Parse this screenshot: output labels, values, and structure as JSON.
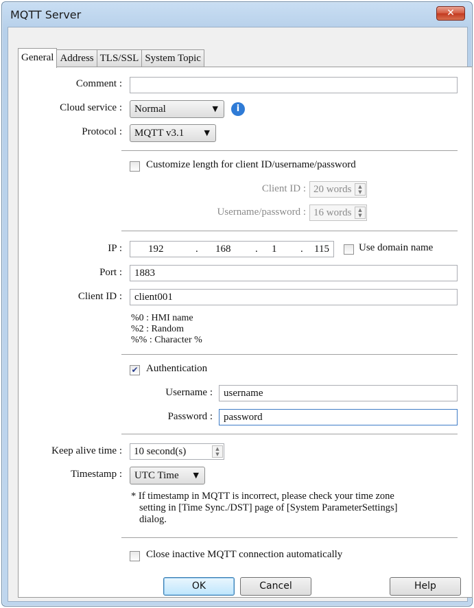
{
  "window": {
    "title": "MQTT Server",
    "close_label": "✕"
  },
  "tabs": [
    {
      "label": "General"
    },
    {
      "label": "Address"
    },
    {
      "label": "TLS/SSL"
    },
    {
      "label": "System Topic"
    }
  ],
  "general": {
    "comment_label": "Comment :",
    "comment_value": "",
    "cloud_label": "Cloud service :",
    "cloud_value": "Normal",
    "protocol_label": "Protocol :",
    "protocol_value": "MQTT v3.1",
    "customize_label": "Customize length for client ID/username/password",
    "customize_checked": false,
    "len_client_label": "Client ID :",
    "len_client_value": "20 words",
    "len_user_label": "Username/password :",
    "len_user_value": "16 words",
    "ip_label": "IP :",
    "ip": [
      "192",
      "168",
      "1",
      "115"
    ],
    "ip_dot": ".",
    "use_domain_label": "Use domain name",
    "use_domain_checked": false,
    "port_label": "Port :",
    "port_value": "1883",
    "client_id_label": "Client ID :",
    "client_id_value": "client001",
    "hints": [
      "%0 : HMI name",
      "%2 : Random",
      "%% : Character %"
    ],
    "auth_label": "Authentication",
    "auth_checked": true,
    "username_label": "Username :",
    "username_value": "username",
    "password_label": "Password :",
    "password_value": "password",
    "keepalive_label": "Keep alive time :",
    "keepalive_value": "10 second(s)",
    "timestamp_label": "Timestamp :",
    "timestamp_value": "UTC Time",
    "timestamp_note": [
      "* If timestamp in MQTT is incorrect, please check your time zone",
      "setting in [Time Sync./DST] page of [System ParameterSettings]",
      "dialog."
    ],
    "close_inactive_label": "Close inactive MQTT connection automatically",
    "close_inactive_checked": false
  },
  "buttons": {
    "ok": "OK",
    "cancel": "Cancel",
    "help": "Help"
  },
  "icons": {
    "info": "info-icon",
    "dropdown": "chevron-down-icon",
    "spin": "spin-up-down-icon",
    "check": "checkmark-icon"
  },
  "colors": {
    "info_blue": "#2f7bd6",
    "titlebar": "#b7d0ea",
    "close_red": "#c2381f"
  }
}
